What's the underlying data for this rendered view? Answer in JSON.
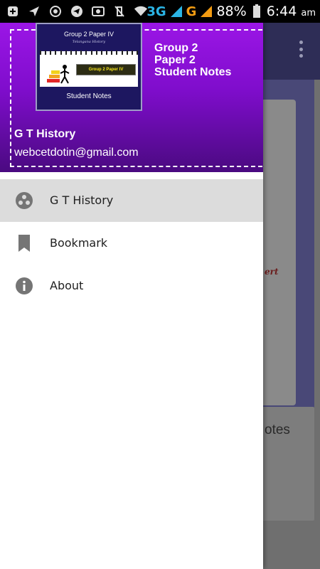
{
  "status_bar": {
    "battery_percent": "88%",
    "time": "6:44",
    "ampm": "am",
    "network_1": "3G",
    "network_2": "G"
  },
  "background_app": {
    "card_text_partial": "ert",
    "card_title_partial": "otes"
  },
  "drawer": {
    "header": {
      "book_title": "Group 2 Paper IV",
      "book_subtitle": "Telangana History",
      "book_banner": "Group 2 Paper IV",
      "book_footer": "Student Notes",
      "app_name_lines": [
        "Group 2",
        "Paper 2",
        "Student Notes"
      ],
      "user_name": "G T History",
      "user_email": "webcetdotin@gmail.com"
    },
    "menu": [
      {
        "label": "G T History",
        "icon": "history-icon",
        "active": true
      },
      {
        "label": "Bookmark",
        "icon": "bookmark-icon",
        "active": false
      },
      {
        "label": "About",
        "icon": "info-icon",
        "active": false
      }
    ]
  },
  "colors": {
    "header_top": "#9b16e6",
    "header_bottom": "#4a0a80",
    "active_item_bg": "#dcdcdc",
    "icon_gray": "#757575",
    "toolbar_bg": "#2e2d56"
  }
}
